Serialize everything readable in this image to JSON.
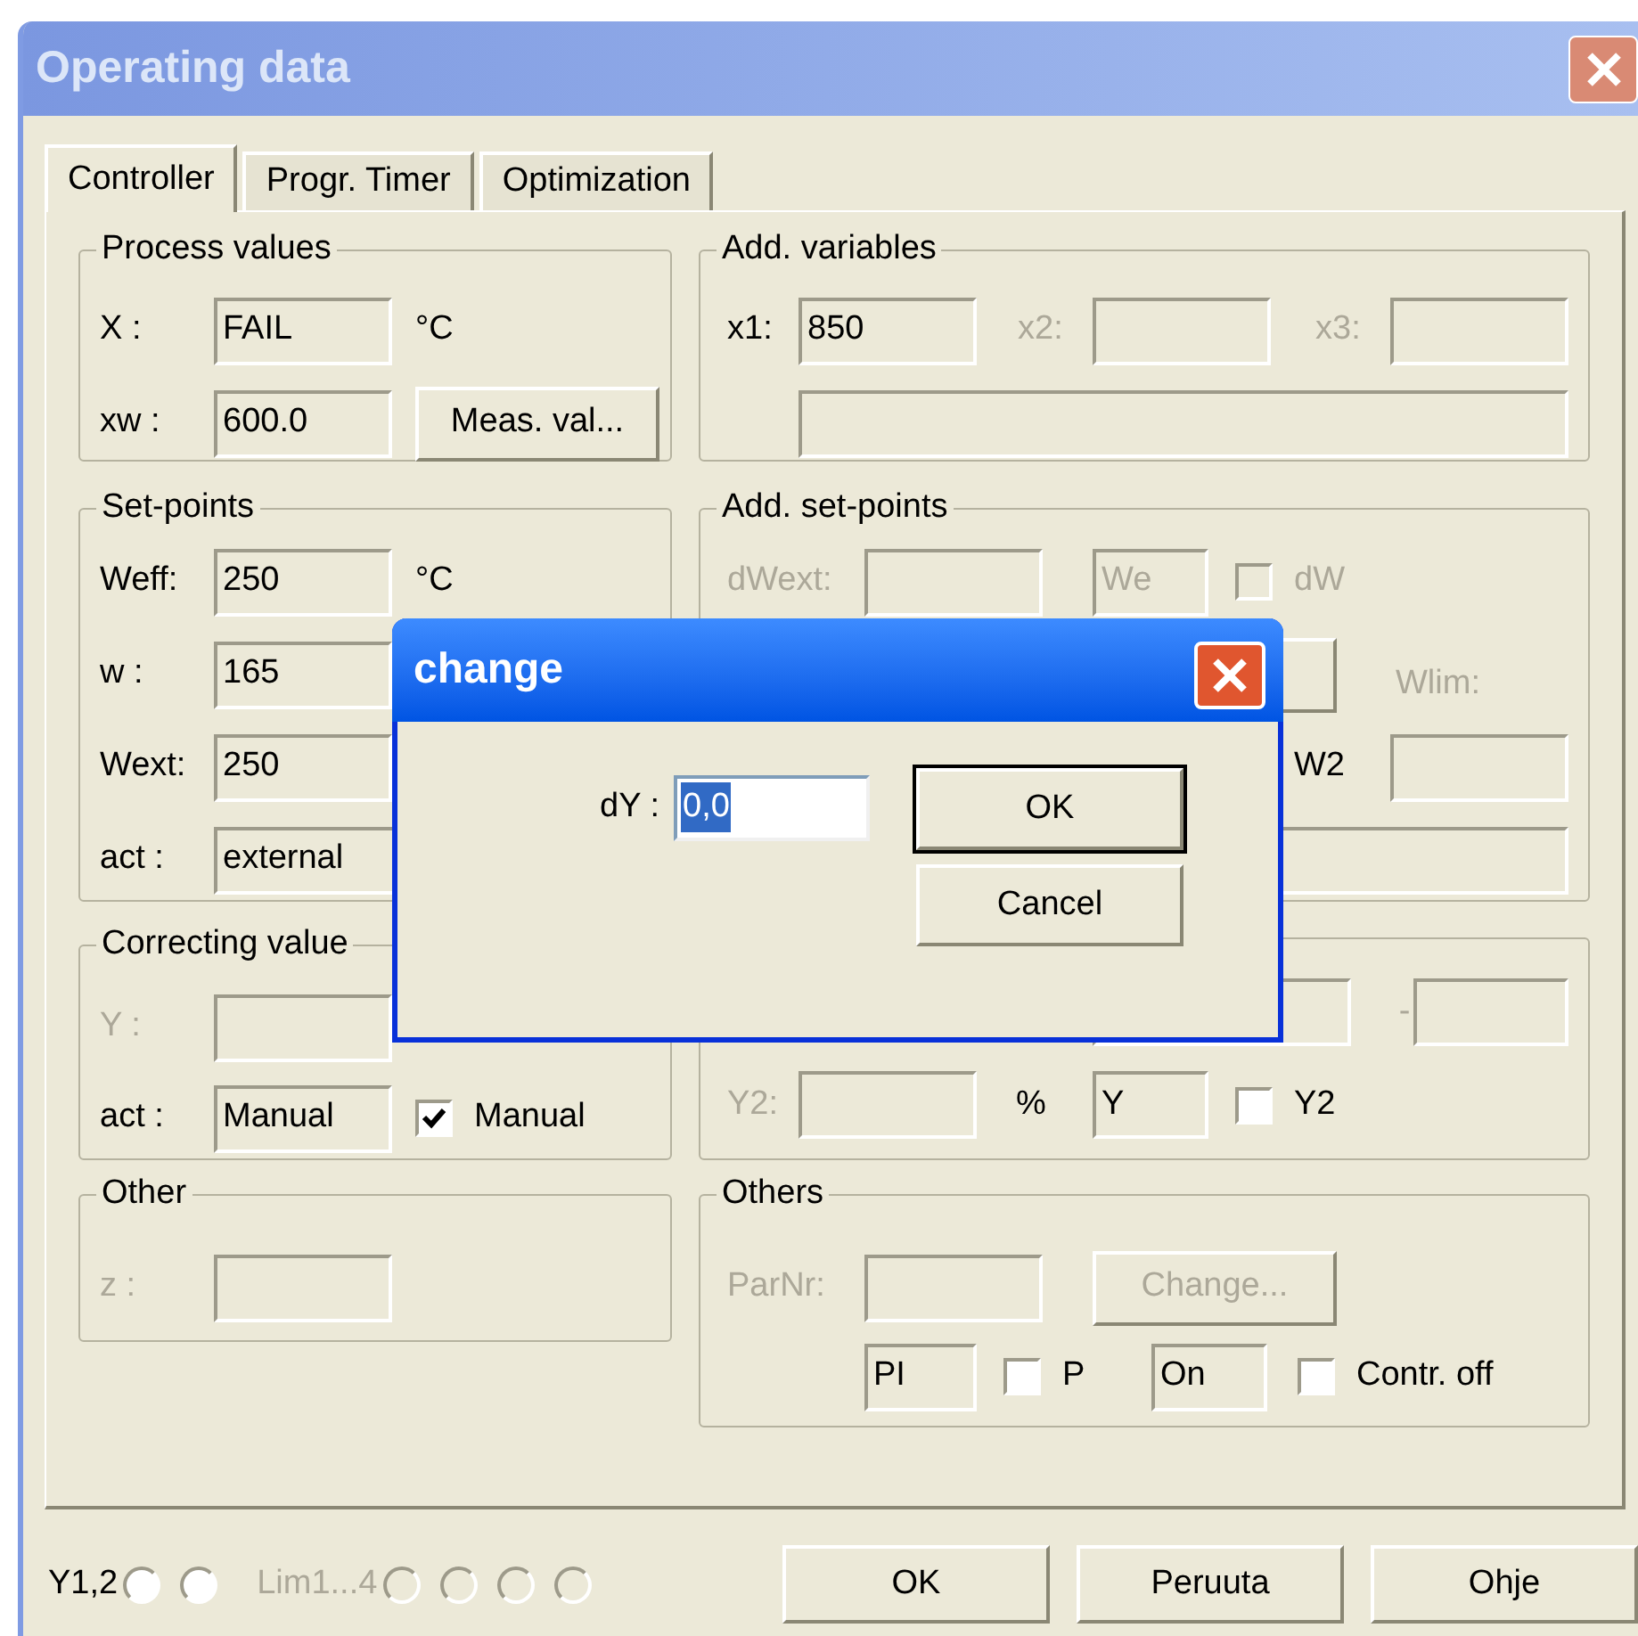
{
  "window": {
    "title": "Operating data"
  },
  "tabs": [
    {
      "label": "Controller",
      "selected": true
    },
    {
      "label": "Progr.  Timer",
      "selected": false
    },
    {
      "label": "Optimization",
      "selected": false
    }
  ],
  "left_groups": [
    {
      "legend": "Process values",
      "rows": [
        {
          "controls": [
            {
              "kind": "label",
              "text": "X :",
              "disabled": false
            },
            {
              "kind": "field",
              "value": "FAIL",
              "disabled": false
            },
            {
              "kind": "unit",
              "text": "°C"
            }
          ]
        },
        {
          "controls": [
            {
              "kind": "label",
              "text": "xw :",
              "disabled": false
            },
            {
              "kind": "field",
              "value": "600.0",
              "disabled": false
            },
            {
              "kind": "button",
              "label": "Meas. val...",
              "disabled": false
            }
          ]
        }
      ]
    },
    {
      "legend": "Set-points",
      "rows": [
        {
          "controls": [
            {
              "kind": "label",
              "text": "Weff:",
              "disabled": false
            },
            {
              "kind": "field",
              "value": "250",
              "disabled": false
            },
            {
              "kind": "unit",
              "text": "°C"
            }
          ]
        },
        {
          "controls": [
            {
              "kind": "label",
              "text": "w :",
              "disabled": false
            },
            {
              "kind": "field",
              "value": "165",
              "disabled": false
            }
          ]
        },
        {
          "controls": [
            {
              "kind": "label",
              "text": "Wext:",
              "disabled": false
            },
            {
              "kind": "field",
              "value": "250",
              "disabled": false
            }
          ]
        },
        {
          "controls": [
            {
              "kind": "label",
              "text": "act :",
              "disabled": false
            },
            {
              "kind": "field",
              "value": "external",
              "disabled": false
            }
          ]
        }
      ]
    },
    {
      "legend": "Correcting value",
      "rows": [
        {
          "controls": [
            {
              "kind": "label",
              "text": "Y :",
              "disabled": true
            },
            {
              "kind": "field"
            }
          ]
        },
        {
          "controls": [
            {
              "kind": "label",
              "text": "act :",
              "disabled": false
            },
            {
              "kind": "field",
              "value": "Manual",
              "disabled": false
            },
            {
              "kind": "checkbox",
              "label": "Manual",
              "checked": true,
              "disabled": false
            }
          ]
        }
      ]
    },
    {
      "legend": "Other",
      "rows": [
        {
          "controls": [
            {
              "kind": "label",
              "text": "z :",
              "disabled": true
            },
            {
              "kind": "field"
            }
          ]
        }
      ]
    }
  ],
  "right_groups": [
    {
      "legend": "Add. variables",
      "rows": [
        {
          "controls": [
            {
              "kind": "label",
              "text": "x1:",
              "disabled": false
            },
            {
              "kind": "field",
              "value": "850",
              "disabled": false
            },
            {
              "kind": "label",
              "text": "x2:",
              "disabled": true
            },
            {
              "kind": "field"
            },
            {
              "kind": "label",
              "text": "x3:",
              "disabled": true
            },
            {
              "kind": "field"
            }
          ]
        },
        {
          "controls": [
            {
              "kind": "field"
            }
          ]
        }
      ]
    },
    {
      "legend": "Add. set-points",
      "rows": [
        {
          "controls": [
            {
              "kind": "label",
              "text": "dWext:",
              "disabled": true
            },
            {
              "kind": "field"
            },
            {
              "kind": "field",
              "value": "We",
              "disabled": true
            },
            {
              "kind": "checkbox",
              "label": "dW",
              "checked": false,
              "disabled": true
            }
          ]
        },
        {
          "controls": [
            {
              "kind": "button"
            },
            {
              "kind": "label",
              "text": "Wlim:",
              "disabled": true
            }
          ]
        },
        {
          "controls": [
            {
              "kind": "label",
              "text": "W2",
              "disabled": false
            },
            {
              "kind": "field"
            }
          ]
        },
        {
          "controls": [
            {
              "kind": "field"
            }
          ]
        }
      ]
    },
    {
      "rows": [
        {
          "controls": [
            {
              "kind": "field"
            },
            {
              "kind": "label",
              "text": "-",
              "disabled": true
            },
            {
              "kind": "field"
            }
          ]
        },
        {
          "controls": [
            {
              "kind": "label",
              "text": "Y2:",
              "disabled": true
            },
            {
              "kind": "field"
            },
            {
              "kind": "unit",
              "text": "%"
            },
            {
              "kind": "field",
              "value": "Y",
              "disabled": false
            },
            {
              "kind": "checkbox",
              "label": "Y2",
              "checked": false,
              "disabled": false
            }
          ]
        }
      ]
    },
    {
      "legend": "Others",
      "rows": [
        {
          "controls": [
            {
              "kind": "label",
              "text": "ParNr:",
              "disabled": true
            },
            {
              "kind": "field"
            },
            {
              "kind": "button",
              "label": "Change...",
              "disabled": true
            }
          ]
        },
        {
          "controls": [
            {
              "kind": "field",
              "value": "PI",
              "disabled": false
            },
            {
              "kind": "checkbox",
              "label": "P",
              "checked": false,
              "disabled": false
            },
            {
              "kind": "field",
              "value": "On",
              "disabled": false
            },
            {
              "kind": "checkbox",
              "label": "Contr. off",
              "checked": false,
              "disabled": false
            }
          ]
        }
      ]
    }
  ],
  "radio_groups": [
    {
      "label": "Y1,2",
      "disabled": false,
      "options": [
        {
          "selected": false
        },
        {
          "selected": false
        }
      ]
    },
    {
      "label": "Lim1...4",
      "disabled": true,
      "options": [
        {
          "selected": false
        },
        {
          "selected": false
        },
        {
          "selected": false
        },
        {
          "selected": false
        }
      ]
    }
  ],
  "buttons": [
    "OK",
    "Peruuta",
    "Ohje"
  ],
  "dialog": {
    "title": "change",
    "label": "dY :",
    "value": "0,0",
    "value_selected": true,
    "buttons": [
      {
        "label": "OK",
        "default": true
      },
      {
        "label": "Cancel",
        "default": false
      }
    ]
  }
}
